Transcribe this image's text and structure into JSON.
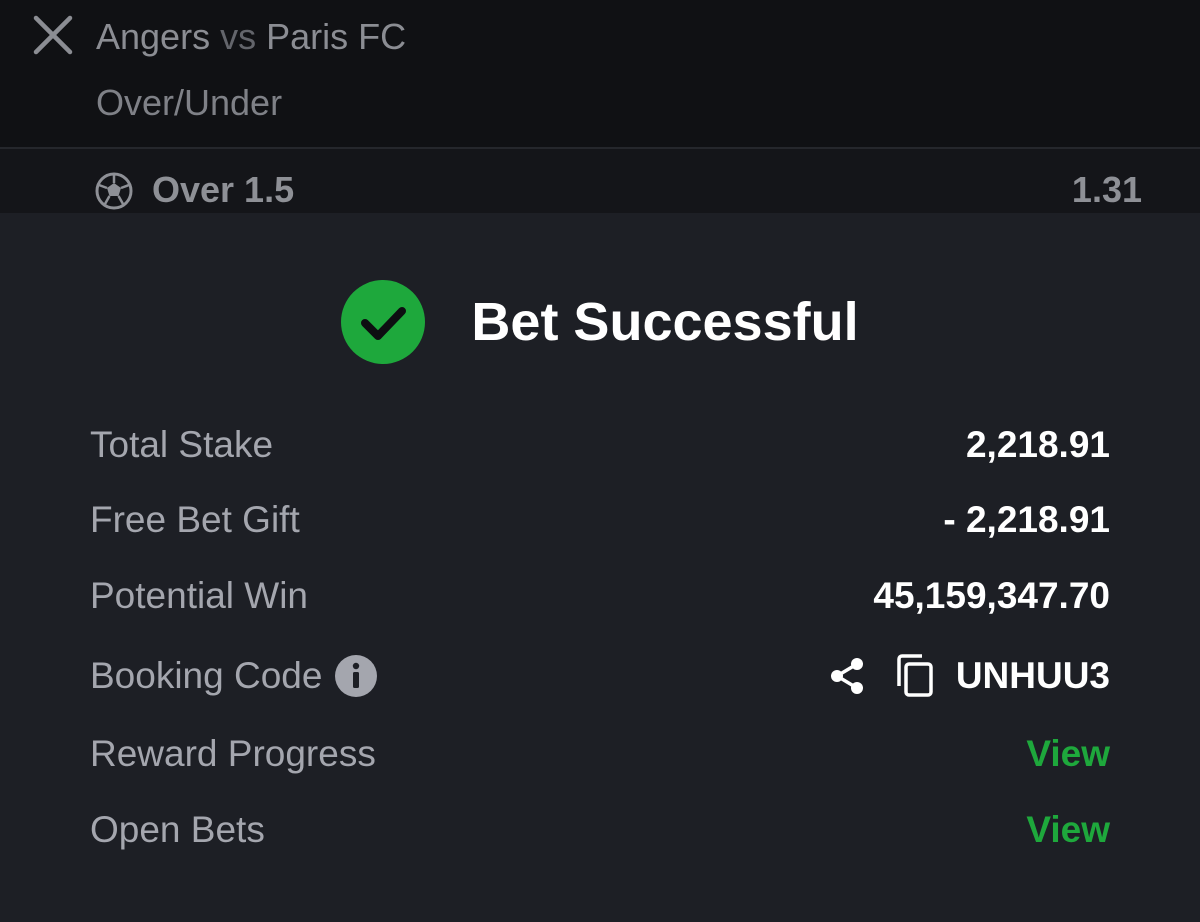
{
  "slip": {
    "home_team": "Angers",
    "vs": "vs",
    "away_team": "Paris FC",
    "market": "Over/Under",
    "selection": "Over 1.5",
    "odds": "1.31"
  },
  "success": {
    "title": "Bet Successful",
    "accent_color": "#1ea83c"
  },
  "details": {
    "total_stake_label": "Total Stake",
    "total_stake_value": "2,218.91",
    "free_bet_label": "Free Bet Gift",
    "free_bet_value": "- 2,218.91",
    "potential_win_label": "Potential Win",
    "potential_win_value": "45,159,347.70",
    "booking_code_label": "Booking Code",
    "booking_code_value": "UNHUU3",
    "reward_label": "Reward Progress",
    "reward_link": "View",
    "open_bets_label": "Open Bets",
    "open_bets_link": "View"
  },
  "icons": {
    "close": "close-icon",
    "sport": "soccer-ball-icon",
    "success": "check-circle-icon",
    "info": "info-icon",
    "share": "share-icon",
    "copy": "copy-icon"
  }
}
